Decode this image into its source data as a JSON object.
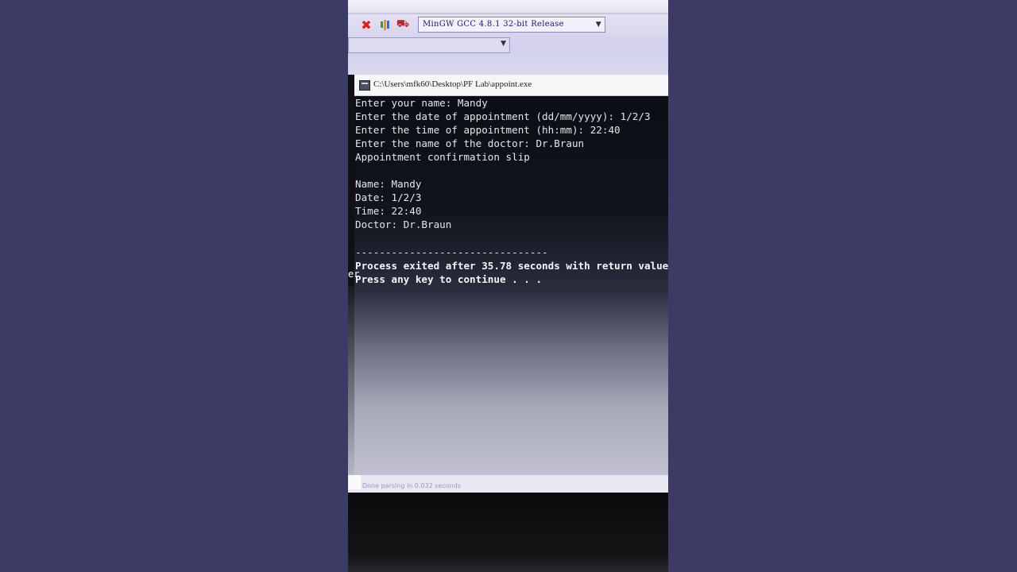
{
  "toolbar": {
    "compiler_label": "MinGW GCC 4.8.1 32-bit Release",
    "icons": [
      "close-icon",
      "chart-icon",
      "profile-icon"
    ]
  },
  "console": {
    "title": "C:\\Users\\mfk60\\Desktop\\PF Lab\\appoint.exe",
    "lines": [
      "Enter your name: Mandy",
      "Enter the date of appointment (dd/mm/yyyy): 1/2/3",
      "Enter the time of appointment (hh:mm): 22:40",
      "Enter the name of the doctor: Dr.Braun",
      "Appointment confirmation slip",
      "",
      "Name: Mandy",
      "Date: 1/2/3",
      "Time: 22:40",
      "Doctor: Dr.Braun",
      "",
      "--------------------------------",
      "Process exited after 35.78 seconds with return value",
      "Press any key to continue . . ."
    ]
  },
  "left_fragment": "er",
  "status": {
    "text": "Done parsing in 0.032 seconds"
  },
  "colors": {
    "background": "#3e3a66",
    "console_text": "#e6e6ea",
    "close_icon": "#d8201c"
  }
}
